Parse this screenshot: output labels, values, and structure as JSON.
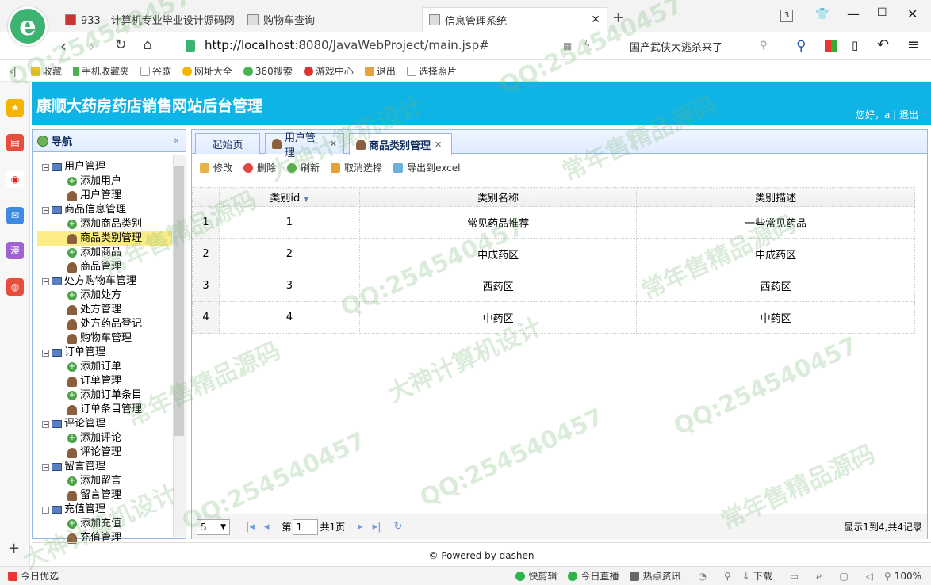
{
  "browser": {
    "tabs": [
      {
        "label": "933 - 计算机专业毕业设计源码网",
        "active": false
      },
      {
        "label": "购物车查询",
        "active": false
      },
      {
        "label": "信息管理系统",
        "active": true
      }
    ],
    "new_tab": "+",
    "tab_count": "3",
    "url_host": "http://localhost",
    "url_path": ":8080/JavaWebProject/main.jsp#",
    "search_text": "国产武侠大逃杀来了",
    "bookmarks": [
      "收藏",
      "手机收藏夹",
      "谷歌",
      "网址大全",
      "360搜索",
      "游戏中心",
      "退出",
      "选择照片"
    ]
  },
  "app": {
    "title": "康顺大药房药店销售网站后台管理",
    "greeting": "您好，a",
    "logout": "退出",
    "nav_title": "导航",
    "nav_collapse": "«",
    "tree": [
      {
        "label": "用户管理",
        "children": [
          "添加用户",
          "用户管理"
        ]
      },
      {
        "label": "商品信息管理",
        "children": [
          "添加商品类别",
          "商品类别管理",
          "添加商品",
          "商品管理"
        ]
      },
      {
        "label": "处方购物车管理",
        "children": [
          "添加处方",
          "处方管理",
          "处方药品登记",
          "购物车管理"
        ]
      },
      {
        "label": "订单管理",
        "children": [
          "添加订单",
          "订单管理",
          "添加订单条目",
          "订单条目管理"
        ]
      },
      {
        "label": "评论管理",
        "children": [
          "添加评论",
          "评论管理"
        ]
      },
      {
        "label": "留言管理",
        "children": [
          "添加留言",
          "留言管理"
        ]
      },
      {
        "label": "充值管理",
        "children": [
          "添加充值",
          "充值管理"
        ]
      }
    ],
    "selected_node": "商品类别管理",
    "main_tabs": [
      {
        "label": "起始页",
        "closable": false,
        "active": false
      },
      {
        "label": "用户管理",
        "closable": true,
        "active": false
      },
      {
        "label": "商品类别管理",
        "closable": true,
        "active": true
      }
    ],
    "toolbar": {
      "edit": "修改",
      "delete": "删除",
      "refresh": "刷新",
      "cancel_select": "取消选择",
      "export": "导出到excel"
    },
    "grid": {
      "columns": [
        "类别id",
        "类别名称",
        "类别描述"
      ],
      "rows": [
        {
          "rn": "1",
          "id": "1",
          "name": "常见药品推荐",
          "desc": "一些常见药品"
        },
        {
          "rn": "2",
          "id": "2",
          "name": "中成药区",
          "desc": "中成药区"
        },
        {
          "rn": "3",
          "id": "3",
          "name": "西药区",
          "desc": "西药区"
        },
        {
          "rn": "4",
          "id": "4",
          "name": "中药区",
          "desc": "中药区"
        }
      ]
    },
    "pager": {
      "page_size": "5",
      "page_prefix": "第",
      "page_value": "1",
      "page_suffix": "共1页",
      "info": "显示1到4,共4记录"
    },
    "footer": "© Powered by dashen"
  },
  "statusbar": {
    "left": "今日优选",
    "items": [
      "快剪辑",
      "今日直播",
      "热点资讯",
      "下载"
    ],
    "zoom": "100%"
  },
  "watermark": {
    "qq": "QQ:254540457",
    "slogan1": "常年售精品源码",
    "slogan2": "大神计算机设计"
  },
  "colors": {
    "header_bg": "#0fb4e6",
    "panel_border": "#95b8e7",
    "selected_bg": "#fbec88"
  }
}
